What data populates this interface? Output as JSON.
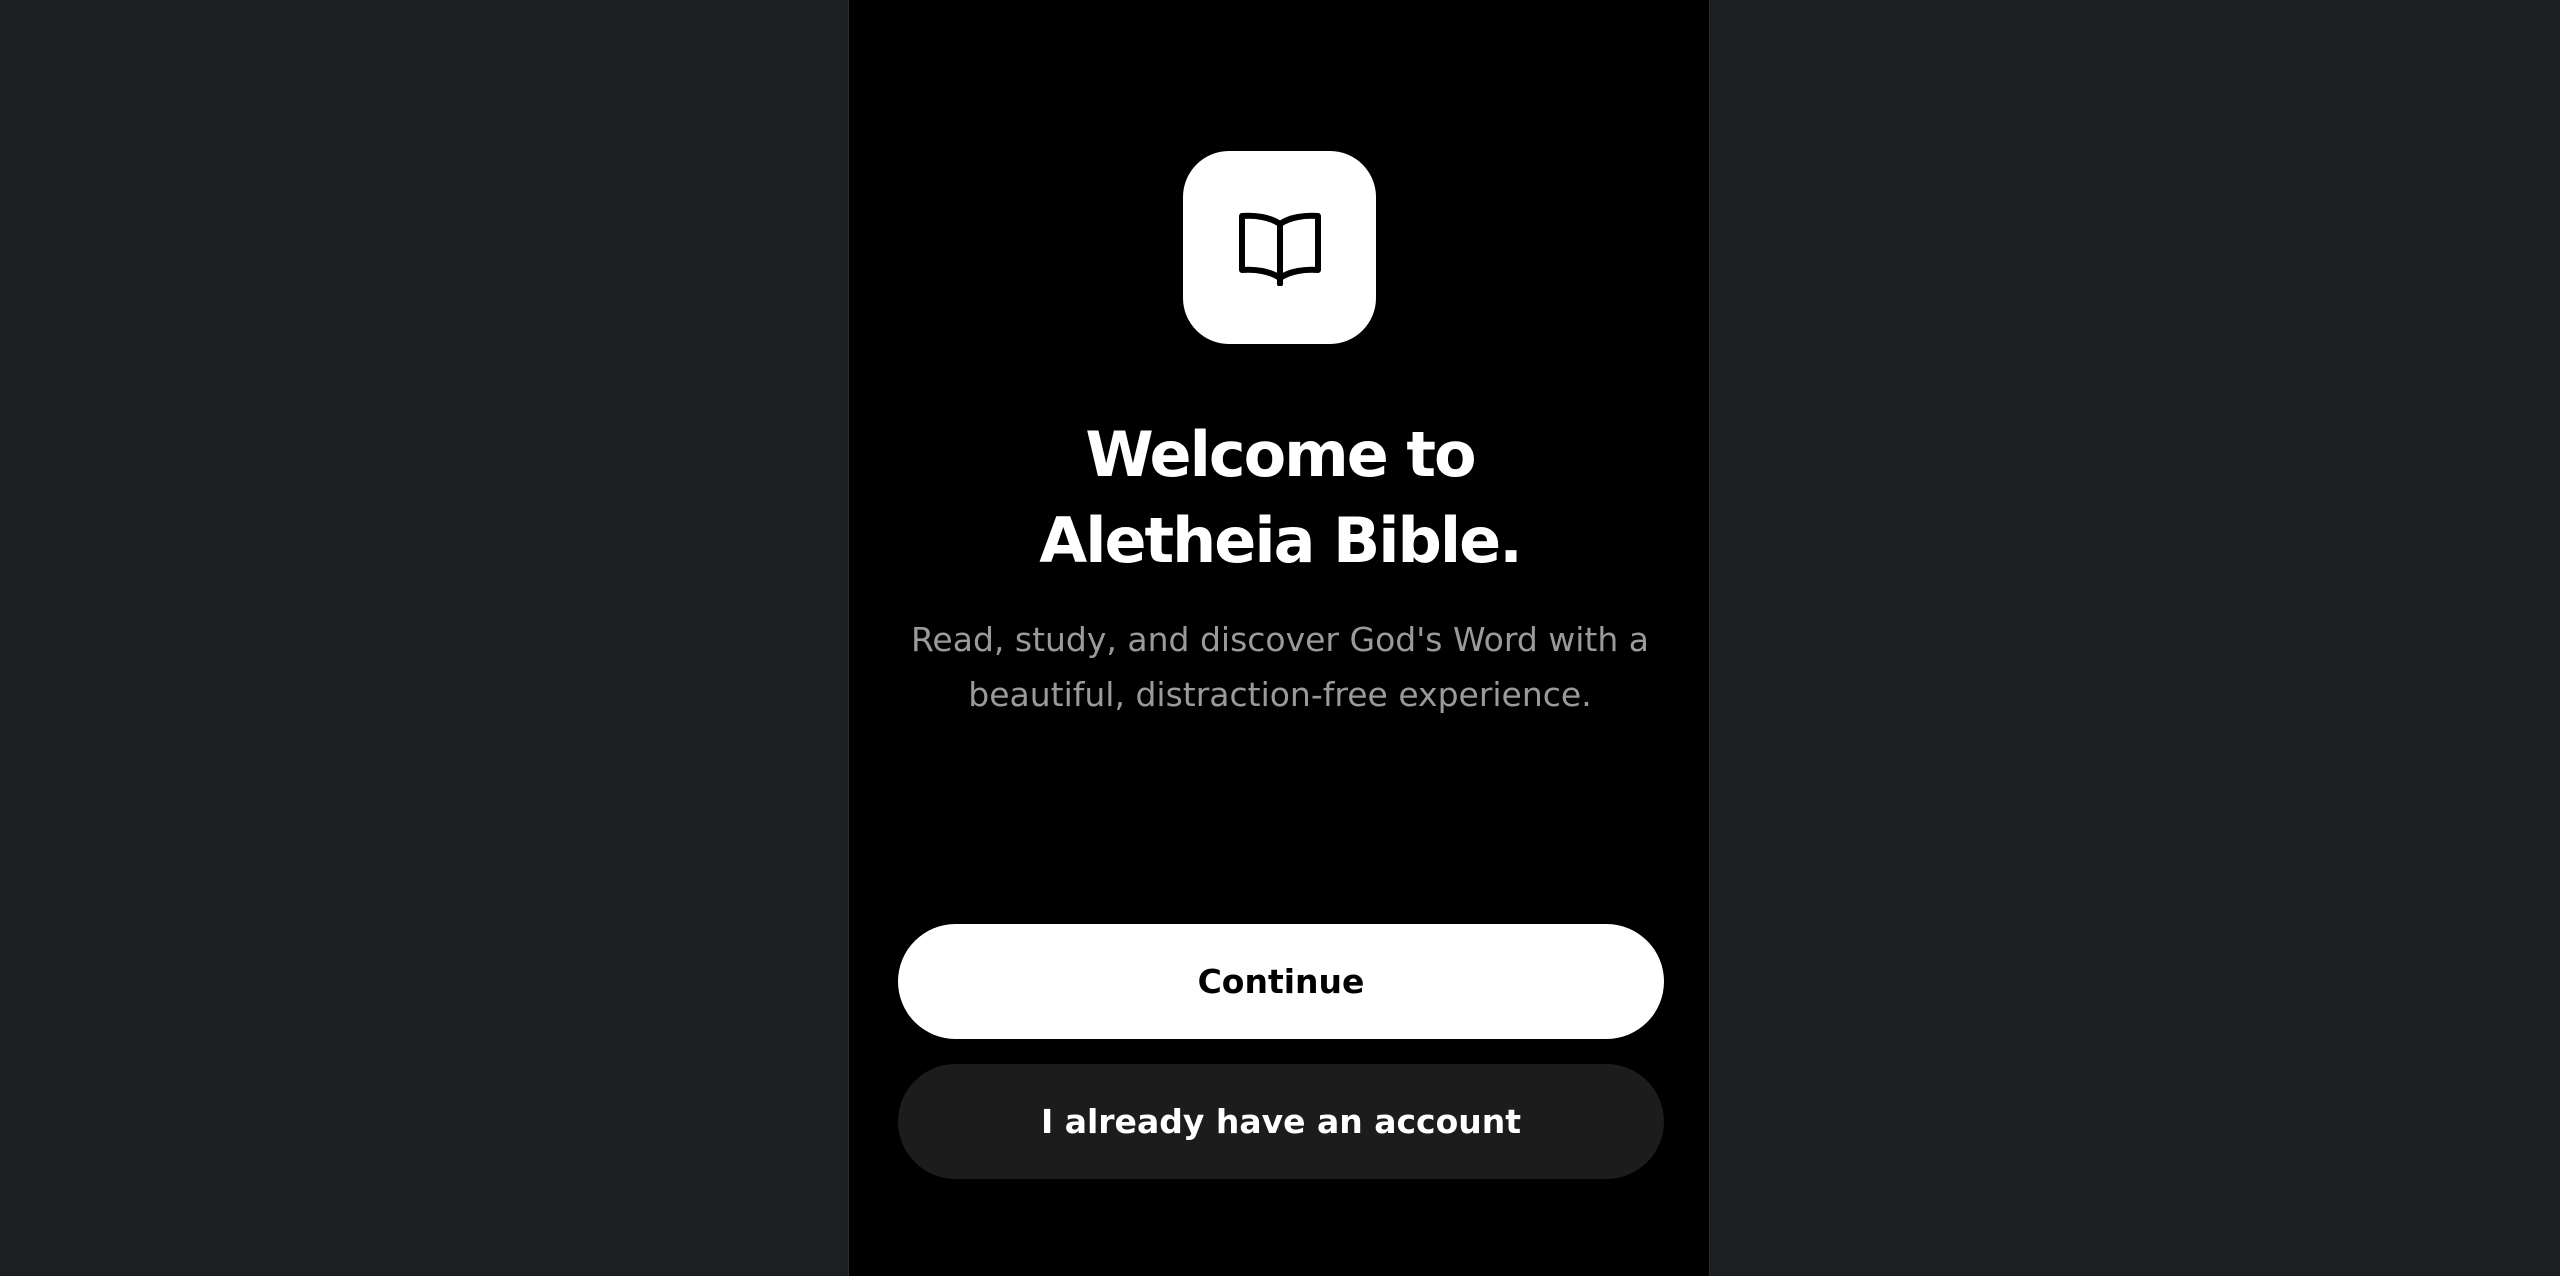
{
  "welcome": {
    "headline_line1": "Welcome to",
    "headline_line2": "Aletheia Bible.",
    "subtitle_line1": "Read, study, and discover God's Word with a",
    "subtitle_line2": "beautiful, distraction-free experience.",
    "logo_icon": "open-book-icon"
  },
  "actions": {
    "continue_label": "Continue",
    "account_label": "I already have an account"
  },
  "colors": {
    "backdrop": "#1c1f21",
    "panel": "#000000",
    "primary_button": "#ffffff",
    "secondary_button": "#1c1c1c",
    "subtitle_text": "#9a9a9a"
  }
}
